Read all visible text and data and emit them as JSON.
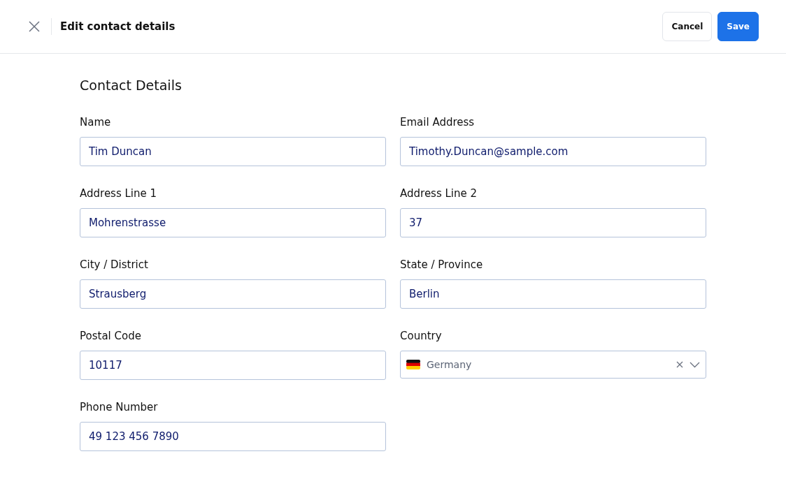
{
  "header": {
    "title": "Edit contact details",
    "buttons": [
      {
        "label": "Cancel",
        "kind": "secondary"
      },
      {
        "label": "Save",
        "kind": "primary"
      }
    ]
  },
  "section": {
    "title": "Contact Details"
  },
  "fields": [
    {
      "label": "Name",
      "value": "Tim Duncan",
      "kind": "text"
    },
    {
      "label": "Email Address",
      "value": "Timothy.Duncan@sample.com",
      "kind": "text"
    },
    {
      "label": "Address Line 1",
      "value": "Mohrenstrasse",
      "kind": "text"
    },
    {
      "label": "Address Line 2",
      "value": "37",
      "kind": "text"
    },
    {
      "label": "City / District",
      "value": "Strausberg",
      "kind": "text"
    },
    {
      "label": "State / Province",
      "value": "Berlin",
      "kind": "text"
    },
    {
      "label": "Postal Code",
      "value": "10117",
      "kind": "text"
    },
    {
      "label": "Country",
      "value": "Germany",
      "kind": "select"
    },
    {
      "label": "Phone Number",
      "value": "49 123 456 7890",
      "kind": "text"
    }
  ]
}
